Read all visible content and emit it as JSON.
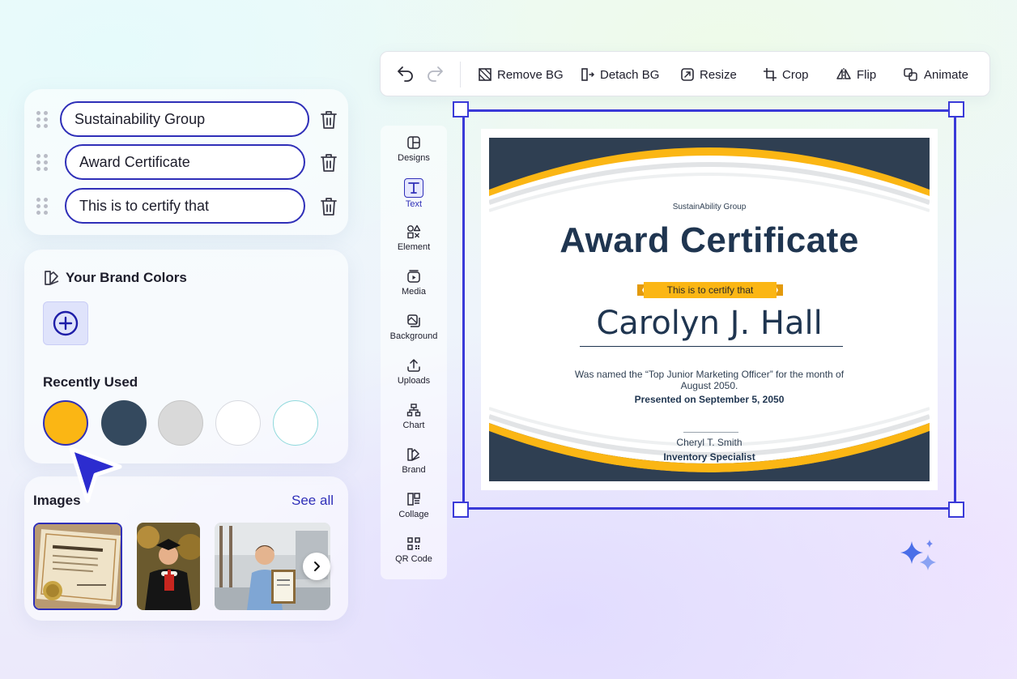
{
  "text_fields": [
    {
      "value": "Sustainability Group"
    },
    {
      "value": "Award Certificate"
    },
    {
      "value": "This is to certify that"
    }
  ],
  "brand_colors": {
    "title": "Your Brand Colors",
    "recent_title": "Recently Used",
    "recent": [
      "#fbb614",
      "#34495e",
      "#d9d9d9",
      "#ffffff",
      "#ffffff"
    ]
  },
  "images": {
    "title": "Images",
    "see_all": "See all"
  },
  "toolbar": {
    "remove_bg": "Remove BG",
    "detach_bg": "Detach BG",
    "resize": "Resize",
    "crop": "Crop",
    "flip": "Flip",
    "animate": "Animate"
  },
  "side_menu": [
    {
      "label": "Designs",
      "icon": "layout-icon"
    },
    {
      "label": "Text",
      "icon": "text-icon"
    },
    {
      "label": "Element",
      "icon": "shapes-icon"
    },
    {
      "label": "Media",
      "icon": "media-icon"
    },
    {
      "label": "Background",
      "icon": "background-icon"
    },
    {
      "label": "Uploads",
      "icon": "upload-icon"
    },
    {
      "label": "Chart",
      "icon": "chart-icon"
    },
    {
      "label": "Brand",
      "icon": "brand-icon"
    },
    {
      "label": "Collage",
      "icon": "collage-icon"
    },
    {
      "label": "QR Code",
      "icon": "qr-code-icon"
    }
  ],
  "certificate": {
    "org": "SustainAbility Group",
    "title": "Award Certificate",
    "ribbon": "This is to certify that",
    "name": "Carolyn J. Hall",
    "description": "Was named the “Top Junior Marketing Officer” for the month of August 2050.",
    "date": "Presented on September 5, 2050",
    "signer": "Cheryl T. Smith",
    "role": "Inventory Specialist",
    "accent": "#fbb614",
    "dark": "#2f3f52"
  }
}
